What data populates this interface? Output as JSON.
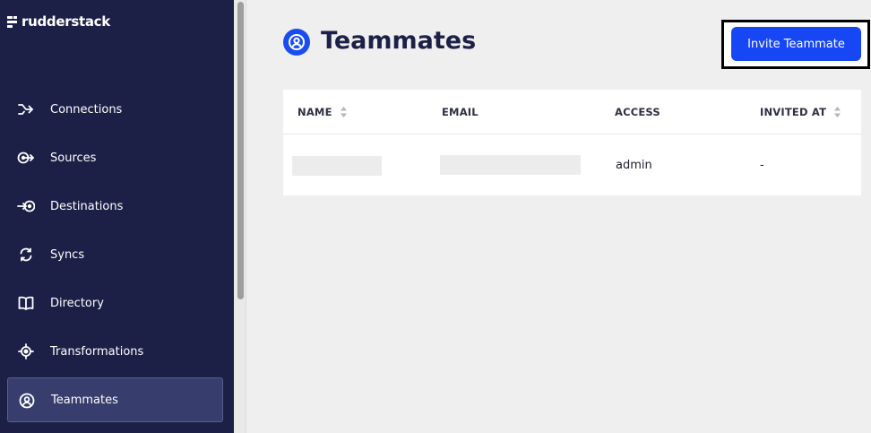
{
  "app": {
    "brand": "rudderstack"
  },
  "sidebar": {
    "items": [
      {
        "label": "Connections",
        "icon": "connections-icon"
      },
      {
        "label": "Sources",
        "icon": "sources-icon"
      },
      {
        "label": "Destinations",
        "icon": "destinations-icon"
      },
      {
        "label": "Syncs",
        "icon": "syncs-icon"
      },
      {
        "label": "Directory",
        "icon": "directory-icon"
      },
      {
        "label": "Transformations",
        "icon": "transformations-icon"
      },
      {
        "label": "Teammates",
        "icon": "teammates-icon",
        "active": true
      }
    ]
  },
  "page": {
    "title": "Teammates",
    "invite_button": "Invite Teammate"
  },
  "table": {
    "columns": [
      "NAME",
      "EMAIL",
      "ACCESS",
      "INVITED AT"
    ],
    "rows": [
      {
        "name": "",
        "email": "",
        "access": "admin",
        "invited_at": "-"
      }
    ]
  },
  "colors": {
    "sidebar_bg": "#1c2046",
    "accent": "#1746f5",
    "active_item_bg": "#373d6c"
  }
}
